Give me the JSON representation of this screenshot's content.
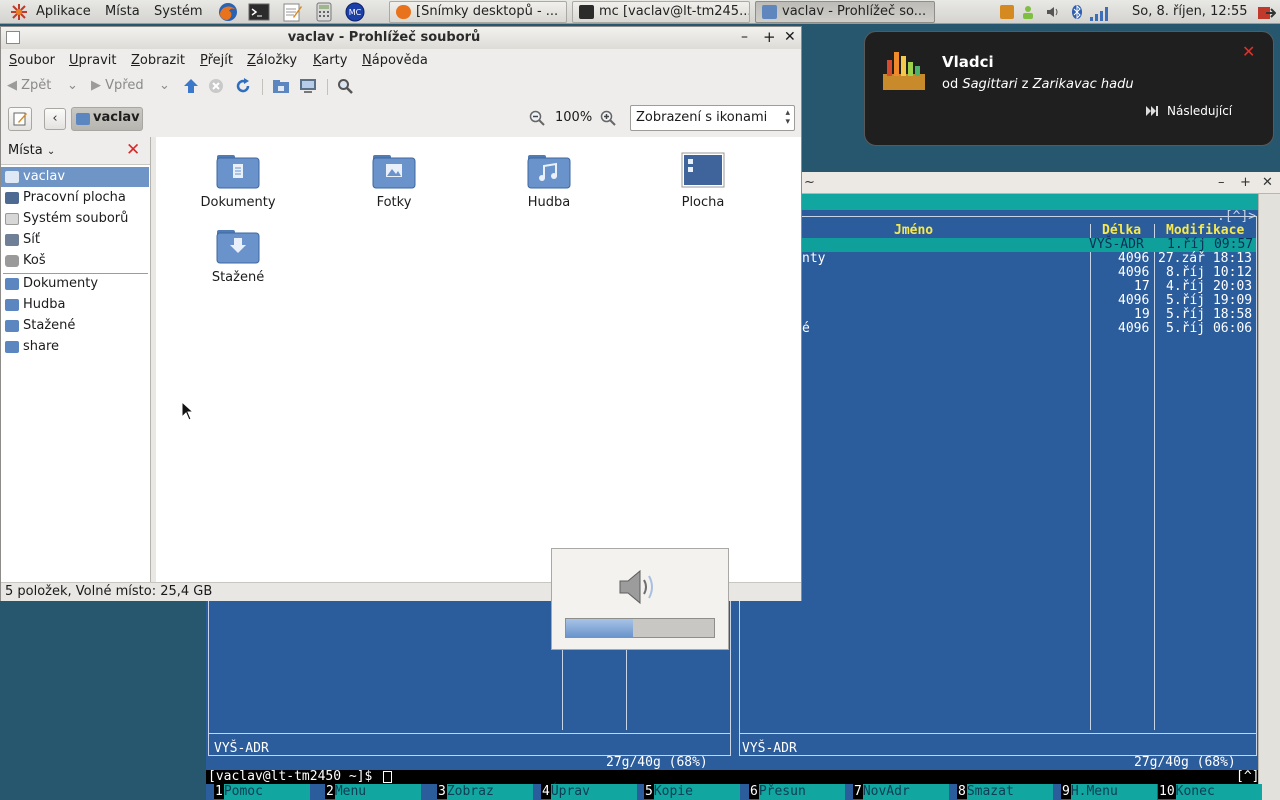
{
  "panel": {
    "menus": [
      "Aplikace",
      "Místa",
      "Systém"
    ],
    "tasks": [
      {
        "label": "[Snímky desktopů - ...",
        "active": false
      },
      {
        "label": "mc [vaclav@lt-tm245...",
        "active": false
      },
      {
        "label": "vaclav - Prohlížeč so...",
        "active": true
      }
    ],
    "clock": "So,  8. říjen, 12:55"
  },
  "notification": {
    "title": "Vladci",
    "subtitle_prefix": "od ",
    "artist": "Sagittari",
    "subtitle_mid": " z ",
    "album": "Zarikavac hadu",
    "next_label": "Následující"
  },
  "file_manager": {
    "title": "vaclav - Prohlížeč souborů",
    "menu": {
      "file": {
        "u": "S",
        "rest": "oubor"
      },
      "edit": {
        "u": "U",
        "rest": "pravit"
      },
      "view": {
        "u": "Z",
        "rest": "obrazit"
      },
      "go": {
        "u": "P",
        "rest": "řejít"
      },
      "bookmarks": {
        "u": "Z",
        "rest": "áložky"
      },
      "tabs": {
        "u": "K",
        "rest": "arty"
      },
      "help": {
        "u": "N",
        "rest": "ápověda"
      }
    },
    "toolbar": {
      "back": "Zpět",
      "forward": "Vpřed"
    },
    "location": {
      "crumb": "vaclav",
      "zoom": "100%",
      "view_mode": "Zobrazení s ikonami"
    },
    "sidebar": {
      "header": "Místa",
      "places": [
        {
          "label": "vaclav",
          "selected": true
        },
        {
          "label": "Pracovní plocha",
          "selected": false
        },
        {
          "label": "Systém souborů",
          "selected": false
        },
        {
          "label": "Síť",
          "selected": false
        },
        {
          "label": "Koš",
          "selected": false
        }
      ],
      "bookmarks": [
        {
          "label": "Dokumenty"
        },
        {
          "label": "Hudba"
        },
        {
          "label": "Stažené"
        },
        {
          "label": "share"
        }
      ]
    },
    "items": [
      {
        "label": "Dokumenty",
        "icon": "documents-folder-icon"
      },
      {
        "label": "Fotky",
        "icon": "pictures-folder-icon"
      },
      {
        "label": "Hudba",
        "icon": "music-folder-icon"
      },
      {
        "label": "Plocha",
        "icon": "desktop-folder-icon"
      },
      {
        "label": "Stažené",
        "icon": "downloads-folder-icon"
      }
    ],
    "status": "5 položek, Volné místo: 25,4 GB"
  },
  "volume": {
    "level": 0.45
  },
  "terminal": {
    "right_panel": {
      "corner": ".[^]>",
      "headers": {
        "name": "Jméno",
        "size": "Délka",
        "modified": "Modifikace"
      },
      "rows": [
        {
          "name": "",
          "size": "VYŠ-ADR",
          "modified": "1.říj 09:57"
        },
        {
          "name": "nty",
          "size": "4096",
          "modified": "27.zář 18:13"
        },
        {
          "name": "",
          "size": "4096",
          "modified": "8.říj 10:12"
        },
        {
          "name": "",
          "size": "17",
          "modified": "4.říj 20:03"
        },
        {
          "name": "",
          "size": "4096",
          "modified": "5.říj 19:09"
        },
        {
          "name": "",
          "size": "19",
          "modified": "5.říj 18:58"
        },
        {
          "name": "é",
          "size": "4096",
          "modified": "5.říj 06:06"
        }
      ],
      "info": "VYŠ-ADR",
      "disk": "27g/40g (68%)"
    },
    "left_panel": {
      "info": "VYŠ-ADR",
      "disk": "27g/40g (68%)"
    },
    "prompt": "[vaclav@lt-tm2450 ~]$ ",
    "prompt_corner": "[^]",
    "fkeys": [
      {
        "n": "1",
        "label": "Pomoc"
      },
      {
        "n": "2",
        "label": "Menu"
      },
      {
        "n": "3",
        "label": "Zobraz"
      },
      {
        "n": "4",
        "label": "Úprav"
      },
      {
        "n": "5",
        "label": "Kopie"
      },
      {
        "n": "6",
        "label": "Přesun"
      },
      {
        "n": "7",
        "label": "NovAdr"
      },
      {
        "n": "8",
        "label": "Smazat"
      },
      {
        "n": "9",
        "label": "H.Menu"
      },
      {
        "n": "10",
        "label": "Konec"
      }
    ]
  },
  "colors": {
    "selection": "#6f95c6",
    "terminal_bg": "#2b5c9b",
    "mc_cyan": "#12a6a1",
    "mc_header": "#f6e84e"
  }
}
